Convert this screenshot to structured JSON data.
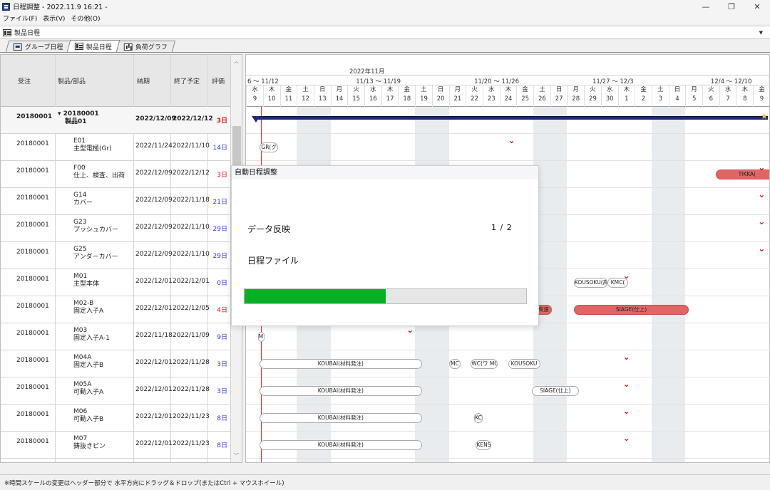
{
  "window": {
    "title": "日程調整 - 2022.11.9 16:21 -",
    "controls": [
      "—",
      "❐",
      "✕"
    ]
  },
  "menu": [
    "ファイル(F)",
    "表示(V)",
    "その他(O)"
  ],
  "selector": {
    "value": "製品日程"
  },
  "tabs": [
    {
      "label": "グループ日程",
      "icon": "group-schedule-icon",
      "active": false
    },
    {
      "label": "製品日程",
      "icon": "gantt-icon",
      "active": true
    },
    {
      "label": "負荷グラフ",
      "icon": "bar-chart-icon",
      "active": false
    }
  ],
  "table": {
    "headers": {
      "order": "受注",
      "part": "製品/部品",
      "due": "納期",
      "end": "終了予定",
      "eval": "評価"
    },
    "rows": [
      {
        "order": "20180001",
        "part1": "▾ 20180001",
        "part2": "製品01",
        "due": "2022/12/09",
        "end": "2022/12/12",
        "eval": "3日",
        "evalColor": "red",
        "summary": true
      },
      {
        "order": "20180001",
        "part1": "E01",
        "part2": "主型電極(Gr)",
        "due": "2022/11/24",
        "end": "2022/11/10",
        "eval": "14日",
        "evalColor": "blue"
      },
      {
        "order": "20180001",
        "part1": "F00",
        "part2": "仕上、検査、出荷",
        "due": "2022/12/09",
        "end": "2022/12/12",
        "eval": "3日",
        "evalColor": "red"
      },
      {
        "order": "20180001",
        "part1": "G14",
        "part2": "カバー",
        "due": "2022/12/09",
        "end": "2022/11/18",
        "eval": "21日",
        "evalColor": "blue"
      },
      {
        "order": "20180001",
        "part1": "G23",
        "part2": "プッシュカバー",
        "due": "2022/12/09",
        "end": "2022/11/10",
        "eval": "29日",
        "evalColor": "blue"
      },
      {
        "order": "20180001",
        "part1": "G25",
        "part2": "アンダーカバー",
        "due": "2022/12/09",
        "end": "2022/11/10",
        "eval": "29日",
        "evalColor": "blue"
      },
      {
        "order": "20180001",
        "part1": "M01",
        "part2": "主型本体",
        "due": "2022/12/01",
        "end": "2022/12/01",
        "eval": "0日",
        "evalColor": "blue"
      },
      {
        "order": "20180001",
        "part1": "M02-B",
        "part2": "固定入子A",
        "due": "2022/12/01",
        "end": "2022/12/05",
        "eval": "4日",
        "evalColor": "red"
      },
      {
        "order": "20180001",
        "part1": "M03",
        "part2": "固定入子A-1",
        "due": "2022/11/18",
        "end": "2022/11/09",
        "eval": "9日",
        "evalColor": "blue"
      },
      {
        "order": "20180001",
        "part1": "M04A",
        "part2": "固定入子B",
        "due": "2022/12/01",
        "end": "2022/11/28",
        "eval": "3日",
        "evalColor": "blue"
      },
      {
        "order": "20180001",
        "part1": "M05A",
        "part2": "可動入子A",
        "due": "2022/12/01",
        "end": "2022/11/28",
        "eval": "3日",
        "evalColor": "blue"
      },
      {
        "order": "20180001",
        "part1": "M06",
        "part2": "可動入子B",
        "due": "2022/12/01",
        "end": "2022/11/23",
        "eval": "8日",
        "evalColor": "blue"
      },
      {
        "order": "20180001",
        "part1": "M07",
        "part2": "鋳抜きピン",
        "due": "2022/12/01",
        "end": "2022/11/23",
        "eval": "8日",
        "evalColor": "blue"
      }
    ]
  },
  "gantt": {
    "month": "2022年11月",
    "weeks": [
      "6 ～ 11/12",
      "11/13 ～ 11/19",
      "11/20 ～ 11/26",
      "11/27 ～ 12/3",
      "12/4 ～ 12/10"
    ],
    "days": [
      {
        "dow": "水",
        "d": "9"
      },
      {
        "dow": "木",
        "d": "10"
      },
      {
        "dow": "金",
        "d": "11"
      },
      {
        "dow": "土",
        "d": "12"
      },
      {
        "dow": "日",
        "d": "13"
      },
      {
        "dow": "月",
        "d": "14"
      },
      {
        "dow": "火",
        "d": "15"
      },
      {
        "dow": "水",
        "d": "16"
      },
      {
        "dow": "木",
        "d": "17"
      },
      {
        "dow": "金",
        "d": "18"
      },
      {
        "dow": "土",
        "d": "19"
      },
      {
        "dow": "日",
        "d": "20"
      },
      {
        "dow": "月",
        "d": "21"
      },
      {
        "dow": "火",
        "d": "22"
      },
      {
        "dow": "水",
        "d": "23"
      },
      {
        "dow": "木",
        "d": "24"
      },
      {
        "dow": "金",
        "d": "25"
      },
      {
        "dow": "土",
        "d": "26"
      },
      {
        "dow": "日",
        "d": "27"
      },
      {
        "dow": "月",
        "d": "28"
      },
      {
        "dow": "火",
        "d": "29"
      },
      {
        "dow": "水",
        "d": "30"
      },
      {
        "dow": "木",
        "d": "1"
      },
      {
        "dow": "金",
        "d": "2"
      },
      {
        "dow": "土",
        "d": "3"
      },
      {
        "dow": "日",
        "d": "4"
      },
      {
        "dow": "月",
        "d": "5"
      },
      {
        "dow": "火",
        "d": "6"
      },
      {
        "dow": "水",
        "d": "7"
      },
      {
        "dow": "木",
        "d": "8"
      },
      {
        "dow": "金",
        "d": "9"
      }
    ],
    "tasks": [
      {
        "row": 1,
        "text": "GR(グ",
        "red": false,
        "startDay": 0.3,
        "days": 1.1
      },
      {
        "row": 2,
        "text": "TIKKA(",
        "red": true,
        "startDay": 27.3,
        "days": 3.7
      },
      {
        "row": 6,
        "text": "KOUSOKU(高",
        "red": false,
        "startDay": 18.9,
        "days": 2.0
      },
      {
        "row": 6,
        "text": "KMC(",
        "red": false,
        "startDay": 20.9,
        "days": 1.2
      },
      {
        "row": 7,
        "text": "高速",
        "red": true,
        "startDay": 16.6,
        "days": 1.0
      },
      {
        "row": 7,
        "text": "SIAGE(仕上)",
        "red": true,
        "startDay": 18.9,
        "days": 6.8
      },
      {
        "row": 8,
        "text": "MI",
        "red": false,
        "startDay": 0.2,
        "days": 0.4
      },
      {
        "row": 9,
        "text": "KOUBAI(材料発注)",
        "red": false,
        "startDay": 0.3,
        "days": 9.6
      },
      {
        "row": 9,
        "text": "MC",
        "red": false,
        "startDay": 11.5,
        "days": 0.7
      },
      {
        "row": 9,
        "text": "WC(ワ MC(",
        "red": false,
        "startDay": 12.8,
        "days": 1.6
      },
      {
        "row": 9,
        "text": "KOUSOKU",
        "red": false,
        "startDay": 15.0,
        "days": 1.9
      },
      {
        "row": 10,
        "text": "KOUBAI(材料発注)",
        "red": false,
        "startDay": 0.3,
        "days": 9.6
      },
      {
        "row": 10,
        "text": "SIAGE(仕上)",
        "red": false,
        "startDay": 16.4,
        "days": 2.8
      },
      {
        "row": 11,
        "text": "KOUBAI(材料発注)",
        "red": false,
        "startDay": 0.3,
        "days": 9.6
      },
      {
        "row": 11,
        "text": "KC",
        "red": false,
        "startDay": 13.0,
        "days": 0.5
      },
      {
        "row": 12,
        "text": "KOUBAI(材料発注)",
        "red": false,
        "startDay": 0.3,
        "days": 9.6
      },
      {
        "row": 12,
        "text": "KENS",
        "red": false,
        "startDay": 13.1,
        "days": 0.9
      }
    ],
    "markers": [
      {
        "row": 1,
        "day": 15.0
      },
      {
        "row": 2,
        "day": 29.8
      },
      {
        "row": 3,
        "day": 29.8
      },
      {
        "row": 4,
        "day": 29.8
      },
      {
        "row": 5,
        "day": 29.8
      },
      {
        "row": 6,
        "day": 21.8
      },
      {
        "row": 8,
        "day": 9.0
      },
      {
        "row": 9,
        "day": 21.8
      },
      {
        "row": 10,
        "day": 21.8
      },
      {
        "row": 11,
        "day": 21.8
      },
      {
        "row": 12,
        "day": 21.8
      }
    ],
    "todayDay": 0.4
  },
  "dialog": {
    "title": "自動日程調整",
    "label": "データ反映",
    "count": "1 / 2",
    "file": "日程ファイル",
    "progress": 0.5
  },
  "status": "※時間スケールの変更はヘッダー部分で 水平方向にドラッグ＆ドロップ(またはCtrl + マウスホイール)",
  "colors": {
    "progress": "#06b025",
    "summaryBar": "#1e2a78",
    "alert": "#d41818",
    "taskRed": "#e06666"
  }
}
